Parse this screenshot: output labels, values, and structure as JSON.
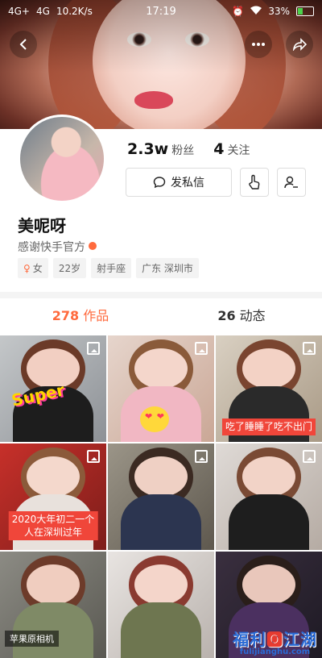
{
  "status_bar": {
    "network1": "4G+",
    "network2": "4G",
    "speed": "10.2K/s",
    "time": "17:19",
    "battery": "33%"
  },
  "nav": {
    "back_icon": "chevron-left-icon",
    "more_icon": "more-dots-icon",
    "share_icon": "share-arrow-icon"
  },
  "stats": {
    "fans_count": "2.3w",
    "fans_label": "粉丝",
    "follow_count": "4",
    "follow_label": "关注"
  },
  "actions": {
    "message_label": "发私信",
    "message_icon": "chat-bubble-icon",
    "poke_icon": "hand-tap-icon",
    "follow_icon": "add-user-icon"
  },
  "profile": {
    "name": "美呢呀",
    "bio": "感谢快手官方",
    "tags": [
      "女",
      "22岁",
      "射手座",
      "广东 深圳市"
    ]
  },
  "tabs": [
    {
      "count": "278",
      "label": "作品"
    },
    {
      "count": "26",
      "label": "动态"
    }
  ],
  "grid": {
    "sticker_super": "Super",
    "captions": {
      "c3": "吃了睡睡了吃不出门",
      "c4_line1": "2020大年初二一个",
      "c4_line2": "人在深圳过年",
      "c7": "苹果原相机"
    }
  },
  "watermark": {
    "main_blue1": "福利",
    "main_red": "🅾",
    "main_blue2": "江湖",
    "sub": "fulijianghu.com"
  },
  "colors": {
    "accent": "#ff6a3d",
    "caption_red": "#f0463a",
    "watermark_blue": "#2a6bd6"
  }
}
